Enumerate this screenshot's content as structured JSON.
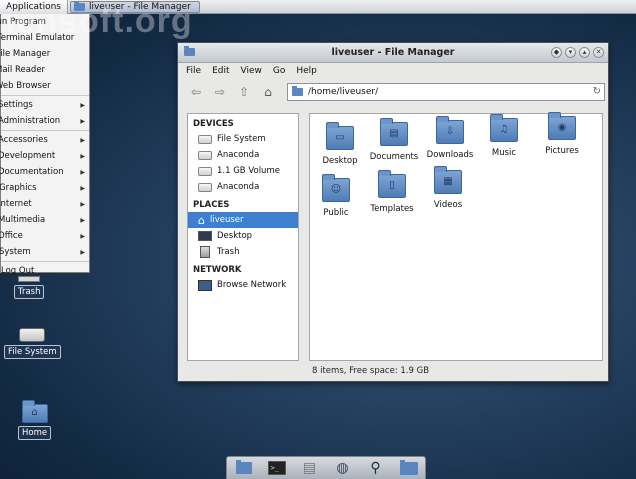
{
  "watermark": "iensoft.org",
  "top_panel": {
    "applications_label": "Applications",
    "task_label": "liveuser - File Manager"
  },
  "app_menu": {
    "items": [
      {
        "label": "Run Program",
        "submenu": false
      },
      {
        "label": "Terminal Emulator",
        "submenu": false
      },
      {
        "label": "File Manager",
        "submenu": false
      },
      {
        "label": "Mail Reader",
        "submenu": false
      },
      {
        "label": "Web Browser",
        "submenu": false
      },
      {
        "label": "Settings",
        "submenu": true
      },
      {
        "label": "Administration",
        "submenu": true
      },
      {
        "label": "Accessories",
        "submenu": true
      },
      {
        "label": "Development",
        "submenu": true
      },
      {
        "label": "Documentation",
        "submenu": true
      },
      {
        "label": "Graphics",
        "submenu": true
      },
      {
        "label": "Internet",
        "submenu": true
      },
      {
        "label": "Multimedia",
        "submenu": true
      },
      {
        "label": "Office",
        "submenu": true
      },
      {
        "label": "System",
        "submenu": true
      },
      {
        "label": "Log Out",
        "submenu": false
      }
    ]
  },
  "desktop_icons": {
    "trash": "Trash",
    "file_system": "File System",
    "home": "Home"
  },
  "window": {
    "title": "liveuser - File Manager",
    "menu": [
      "File",
      "Edit",
      "View",
      "Go",
      "Help"
    ],
    "location": "/home/liveuser/",
    "sidebar": {
      "devices_header": "DEVICES",
      "devices": [
        "File System",
        "Anaconda",
        "1.1 GB Volume",
        "Anaconda"
      ],
      "places_header": "PLACES",
      "places": [
        "liveuser",
        "Desktop",
        "Trash"
      ],
      "network_header": "NETWORK",
      "network": [
        "Browse Network"
      ]
    },
    "files": [
      {
        "name": "Desktop",
        "icon": "desktop-folder-icon"
      },
      {
        "name": "Documents",
        "icon": "documents-folder-icon"
      },
      {
        "name": "Downloads",
        "icon": "downloads-folder-icon"
      },
      {
        "name": "Music",
        "icon": "music-folder-icon"
      },
      {
        "name": "Pictures",
        "icon": "pictures-folder-icon"
      },
      {
        "name": "Public",
        "icon": "public-folder-icon"
      },
      {
        "name": "Templates",
        "icon": "templates-folder-icon"
      },
      {
        "name": "Videos",
        "icon": "videos-folder-icon"
      }
    ],
    "status": "8 items, Free space: 1.9 GB"
  },
  "colors": {
    "selection": "#3f7fd0",
    "folder": "#5b86bd"
  }
}
